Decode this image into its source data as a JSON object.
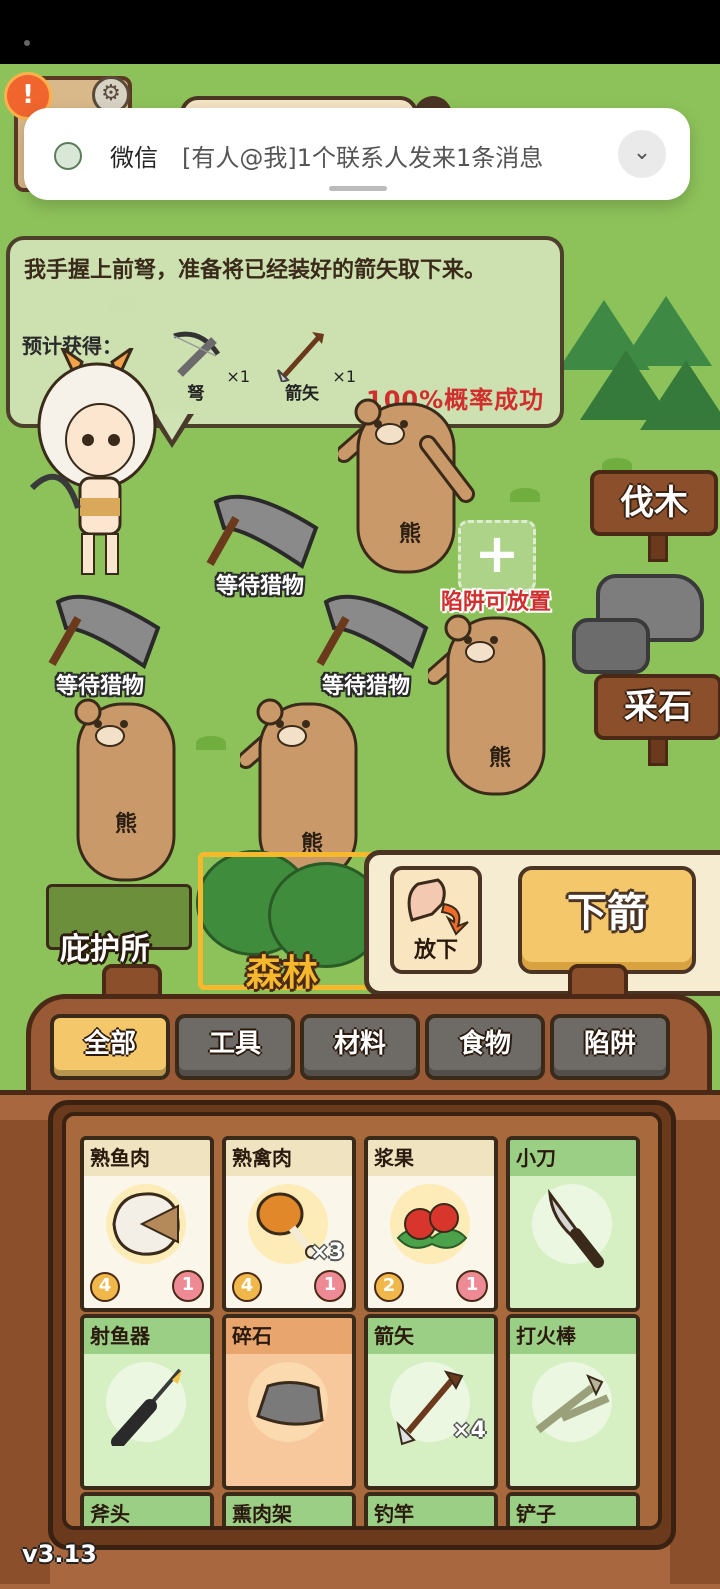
{
  "notification": {
    "app": "微信",
    "message": "[有人@我]1个联系人发来1条消息"
  },
  "hud": {
    "alert": "!",
    "gear": "⚙"
  },
  "bubble": {
    "text": "我手握上前弩，准备将已经装好的箭矢取下来。",
    "expect_label": "预计获得：",
    "rewards": [
      {
        "name": "弩",
        "qty": "×1"
      },
      {
        "name": "箭矢",
        "qty": "×1"
      }
    ],
    "success": "100%概率成功"
  },
  "bears": {
    "label": "熊"
  },
  "traps": {
    "waiting_label": "等待猎物",
    "slot_plus": "+",
    "slot_label": "陷阱可放置"
  },
  "signs": {
    "wood": "伐木",
    "stone": "采石"
  },
  "locations": {
    "shelter": "庇护所",
    "forest": "森林"
  },
  "actions": {
    "put_down": "放下",
    "take_arrow": "下箭"
  },
  "backpack": {
    "tabs": [
      {
        "label": "全部",
        "active": true
      },
      {
        "label": "工具",
        "active": false
      },
      {
        "label": "材料",
        "active": false
      },
      {
        "label": "食物",
        "active": false
      },
      {
        "label": "陷阱",
        "active": false
      }
    ],
    "items": [
      {
        "name": "熟鱼肉",
        "kind": "food",
        "left": "4",
        "right": "1",
        "qty": "",
        "icon": "fish-steak-icon"
      },
      {
        "name": "熟禽肉",
        "kind": "food",
        "left": "4",
        "right": "1",
        "qty": "×3",
        "icon": "drumstick-icon"
      },
      {
        "name": "浆果",
        "kind": "food",
        "left": "2",
        "right": "1",
        "qty": "",
        "icon": "berries-icon"
      },
      {
        "name": "小刀",
        "kind": "tool",
        "left": "",
        "right": "",
        "qty": "",
        "icon": "knife-icon"
      },
      {
        "name": "射鱼器",
        "kind": "tool",
        "left": "",
        "right": "",
        "qty": "",
        "icon": "spear-gun-icon"
      },
      {
        "name": "碎石",
        "kind": "mat",
        "left": "",
        "right": "",
        "qty": "",
        "icon": "rock-icon"
      },
      {
        "name": "箭矢",
        "kind": "tool",
        "left": "",
        "right": "",
        "qty": "×4",
        "icon": "arrow-icon"
      },
      {
        "name": "打火棒",
        "kind": "tool",
        "left": "",
        "right": "",
        "qty": "",
        "icon": "fire-stick-icon"
      },
      {
        "name": "斧头",
        "kind": "tool",
        "left": "",
        "right": "",
        "qty": "",
        "icon": "axe-icon"
      },
      {
        "name": "熏肉架",
        "kind": "tool",
        "left": "",
        "right": "",
        "qty": "",
        "icon": "smoke-rack-icon"
      },
      {
        "name": "钓竿",
        "kind": "tool",
        "left": "",
        "right": "",
        "qty": "",
        "icon": "fishing-rod-icon"
      },
      {
        "name": "铲子",
        "kind": "tool",
        "left": "",
        "right": "",
        "qty": "",
        "icon": "shovel-icon"
      }
    ]
  },
  "version": "v3.13"
}
